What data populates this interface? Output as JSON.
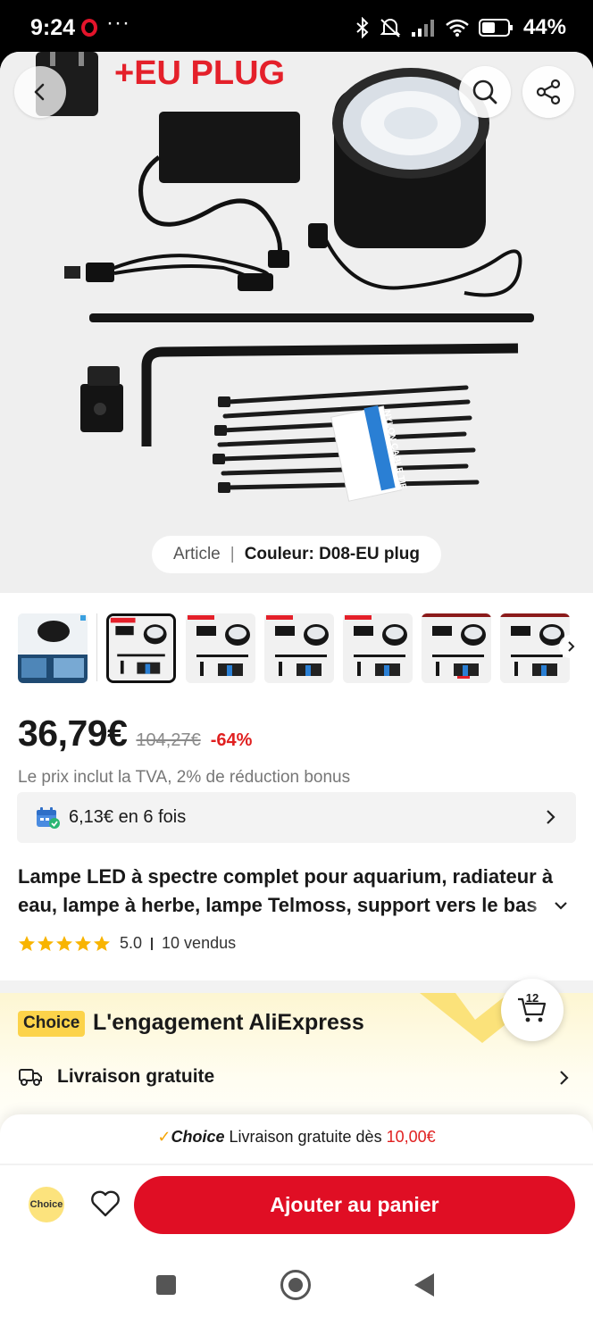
{
  "status_bar": {
    "time": "9:24",
    "dots": "···",
    "battery": "44%"
  },
  "hero": {
    "plug_text": "+EU PLUG",
    "cable_tie_label": "NYLON CABLE TIE",
    "variant_prefix": "Article",
    "variant_separator": "|",
    "variant_value": "Couleur: D08-EU plug"
  },
  "product": {
    "price": "36,79€",
    "old_price": "104,27€",
    "discount": "-64%",
    "vat_note": "Le prix inclut la TVA, 2% de réduction bonus",
    "installment": "6,13€ en 6 fois",
    "title": "Lampe LED à spectre complet pour aquarium, radiateur à eau, lampe à herbe, lampe Telmoss, support vers le bas",
    "rating": "5.0",
    "sold": "10 vendus"
  },
  "choice": {
    "badge": "Choice",
    "title": "L'engagement AliExpress",
    "delivery": "Livraison gratuite",
    "cart_count": "12"
  },
  "bottom": {
    "promo_word": "Choice",
    "promo_text": " Livraison gratuite dès ",
    "promo_amount": "10,00€",
    "coin_label": "Choice",
    "add_to_cart": "Ajouter au panier"
  },
  "colors": {
    "accent_red": "#e00e24",
    "choice_yellow": "#fcd34a",
    "discount_red": "#e02020"
  }
}
